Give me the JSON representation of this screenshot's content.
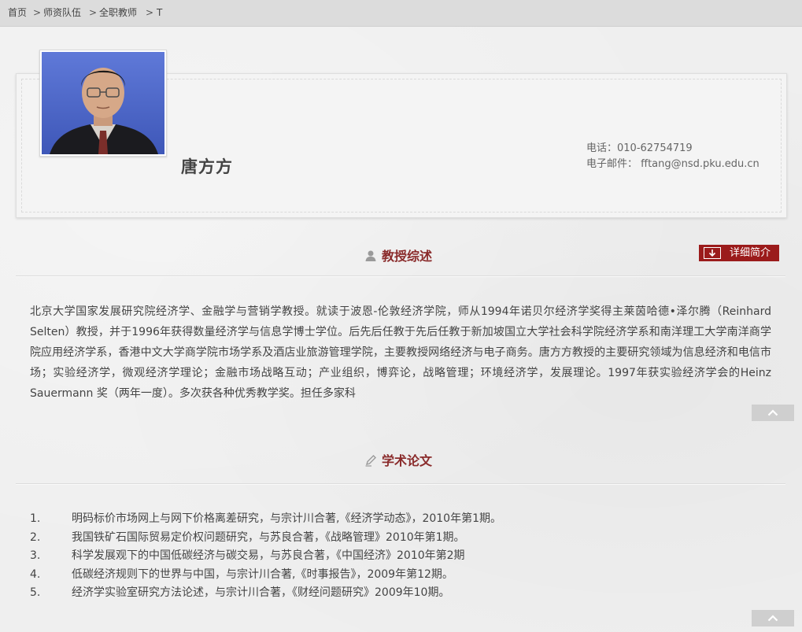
{
  "breadcrumb": {
    "home": "首页",
    "faculty": "师资队伍",
    "fulltime": "全职教师",
    "letter": "T",
    "separator": ">"
  },
  "profile": {
    "name": "唐方方",
    "phone": "电话：010-62754719",
    "email": "电子邮件： fftang@nsd.pku.edu.cn"
  },
  "overview": {
    "title": "教授综述",
    "detail_button": "详细简介",
    "intro_text": "北京大学国家发展研究院经济学、金融学与营销学教授。就读于波恩-伦敦经济学院，师从1994年诺贝尔经济学奖得主莱茵哈德•泽尔腾（Reinhard Selten）教授，并于1996年获得数量经济学与信息学博士学位。后先后任教于先后任教于新加坡国立大学社会科学院经济学系和南洋理工大学南洋商学院应用经济学系，香港中文大学商学院市场学系及酒店业旅游管理学院，主要教授网络经济与电子商务。唐方方教授的主要研究领域为信息经济和电信市场；实验经济学，微观经济学理论；金融市场战略互动；产业组织，博弈论，战略管理；环境经济学，发展理论。1997年获实验经济学会的Heinz Sauermann 奖（两年一度）。多次获各种优秀教学奖。担任多家科"
  },
  "papers": {
    "title": "学术论文",
    "items": [
      {
        "num": "1.",
        "text": "明码标价市场网上与网下价格离差研究，与宗计川合著,《经济学动态》，2010年第1期。"
      },
      {
        "num": "2.",
        "text": "我国铁矿石国际贸易定价权问题研究，与苏良合著，《战略管理》2010年第1期。"
      },
      {
        "num": "3.",
        "text": "科学发展观下的中国低碳经济与碳交易，与苏良合著，《中国经济》2010年第2期"
      },
      {
        "num": "4.",
        "text": "低碳经济规则下的世界与中国，与宗计川合著,《时事报告》，2009年第12期。"
      },
      {
        "num": "5.",
        "text": "经济学实验室研究方法论述，与宗计川合著，《财经问题研究》2009年10期。"
      }
    ]
  },
  "colors": {
    "accent": "#9b1b1b",
    "section_title": "#8a2b2b",
    "breadcrumb_bg": "#dcdcdc"
  },
  "icons": {
    "overview": "person-icon",
    "papers": "pencil-icon",
    "detail": "download-icon",
    "scroll": "chevron-up-icon"
  }
}
